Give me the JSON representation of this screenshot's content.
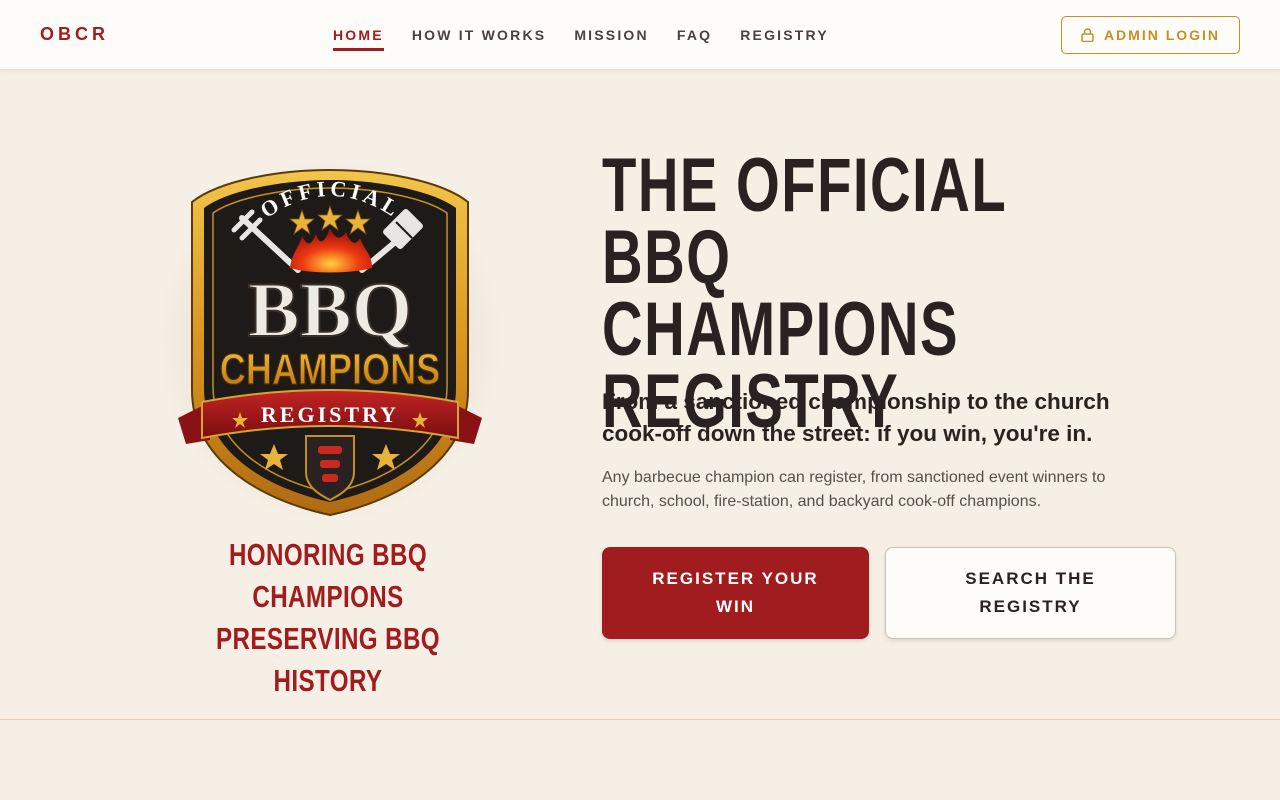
{
  "brand": "OBCR",
  "nav": {
    "items": [
      {
        "label": "HOME",
        "active": true
      },
      {
        "label": "HOW IT WORKS",
        "active": false
      },
      {
        "label": "MISSION",
        "active": false
      },
      {
        "label": "FAQ",
        "active": false
      },
      {
        "label": "REGISTRY",
        "active": false
      }
    ],
    "admin_label": "ADMIN LOGIN",
    "admin_icon": "lock-icon"
  },
  "logo": {
    "top_text": "OFFICIAL",
    "main_text": "BBQ",
    "champions_text": "CHAMPIONS",
    "ribbon_text": "REGISTRY"
  },
  "tagline": {
    "line1": "HONORING BBQ CHAMPIONS",
    "line2": "PRESERVING BBQ HISTORY"
  },
  "hero": {
    "title_line1": "THE OFFICIAL BBQ",
    "title_line2": "CHAMPIONS",
    "title_line3": "REGISTRY",
    "subtitle": "From a sanctioned championship to the church cook-off down the street: if you win, you're in.",
    "description": "Any barbecue champion can register, from sanctioned event winners to church, school, fire-station, and backyard cook-off champions."
  },
  "buttons": {
    "register": "REGISTER YOUR WIN",
    "search": "SEARCH THE REGISTRY"
  },
  "colors": {
    "accent": "#a01c1e",
    "gold": "#c48f25",
    "background": "#f5efe5",
    "header": "#fefcf8",
    "text": "#2a2220"
  }
}
